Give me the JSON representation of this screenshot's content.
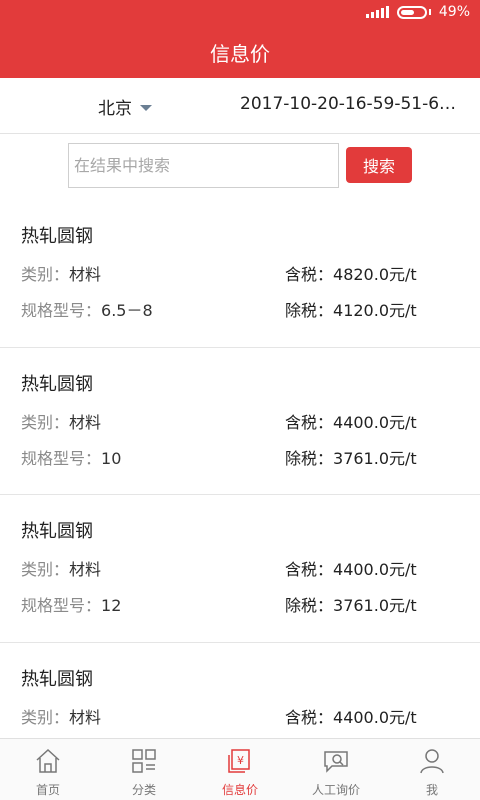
{
  "status": {
    "battery": "49%"
  },
  "header": {
    "title": "信息价"
  },
  "filter": {
    "city": "北京",
    "datetime": "2017-10-20-16-59-51-648..."
  },
  "search": {
    "placeholder": "在结果中搜索",
    "button_label": "搜索"
  },
  "labels": {
    "category": "类别：",
    "spec": "规格型号：",
    "tax_incl": "含税：",
    "tax_excl": "除税："
  },
  "items": [
    {
      "name": "热轧圆钢",
      "category": "材料",
      "spec": "6.5－8",
      "price_incl": "4820.0元/t",
      "price_excl": "4120.0元/t"
    },
    {
      "name": "热轧圆钢",
      "category": "材料",
      "spec": "10",
      "price_incl": "4400.0元/t",
      "price_excl": "3761.0元/t"
    },
    {
      "name": "热轧圆钢",
      "category": "材料",
      "spec": "12",
      "price_incl": "4400.0元/t",
      "price_excl": "3761.0元/t"
    },
    {
      "name": "热轧圆钢",
      "category": "材料",
      "spec": "",
      "price_incl": "4400.0元/t",
      "price_excl": ""
    }
  ],
  "tabs": [
    {
      "label": "首页",
      "icon": "home-icon"
    },
    {
      "label": "分类",
      "icon": "category-icon"
    },
    {
      "label": "信息价",
      "icon": "price-info-icon"
    },
    {
      "label": "人工询价",
      "icon": "inquiry-icon"
    },
    {
      "label": "我",
      "icon": "user-icon"
    }
  ],
  "colors": {
    "brand": "#e23b3b"
  }
}
